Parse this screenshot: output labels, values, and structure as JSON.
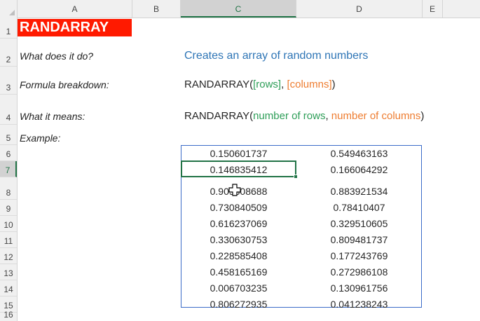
{
  "columns": [
    "A",
    "B",
    "C",
    "D",
    "E"
  ],
  "rows": [
    "1",
    "2",
    "3",
    "4",
    "5",
    "6",
    "7",
    "8",
    "9",
    "10",
    "11",
    "12",
    "13",
    "14",
    "15",
    "16"
  ],
  "title": "RANDARRAY",
  "labels": {
    "what": "What does it do?",
    "breakdown": "Formula breakdown:",
    "means": "What it means:",
    "example": "Example:"
  },
  "description": "Creates an array of random numbers",
  "formula": {
    "fn": "RANDARRAY(",
    "arg1": "[rows]",
    "sep": ", ",
    "arg2": "[columns]",
    "close": ")"
  },
  "meaning": {
    "fn": "RANDARRAY(",
    "arg1": "number of rows",
    "sep": ", ",
    "arg2": "number of columns",
    "close": ")"
  },
  "values": [
    [
      "0.150601737",
      "0.549463163"
    ],
    [
      "0.146835412",
      "0.166064292"
    ],
    [
      "0.905308688",
      "0.883921534"
    ],
    [
      "0.730840509",
      "0.78410407"
    ],
    [
      "0.616237069",
      "0.329510605"
    ],
    [
      "0.330630753",
      "0.809481737"
    ],
    [
      "0.228585408",
      "0.177243769"
    ],
    [
      "0.458165169",
      "0.272986108"
    ],
    [
      "0.006703235",
      "0.130961756"
    ],
    [
      "0.806272935",
      "0.041238243"
    ]
  ],
  "colors": {
    "title_bg": "#ff1a00",
    "description": "#2e75b6",
    "arg1": "#2e9e58",
    "arg2": "#ee7d31",
    "selection": "#217346"
  }
}
